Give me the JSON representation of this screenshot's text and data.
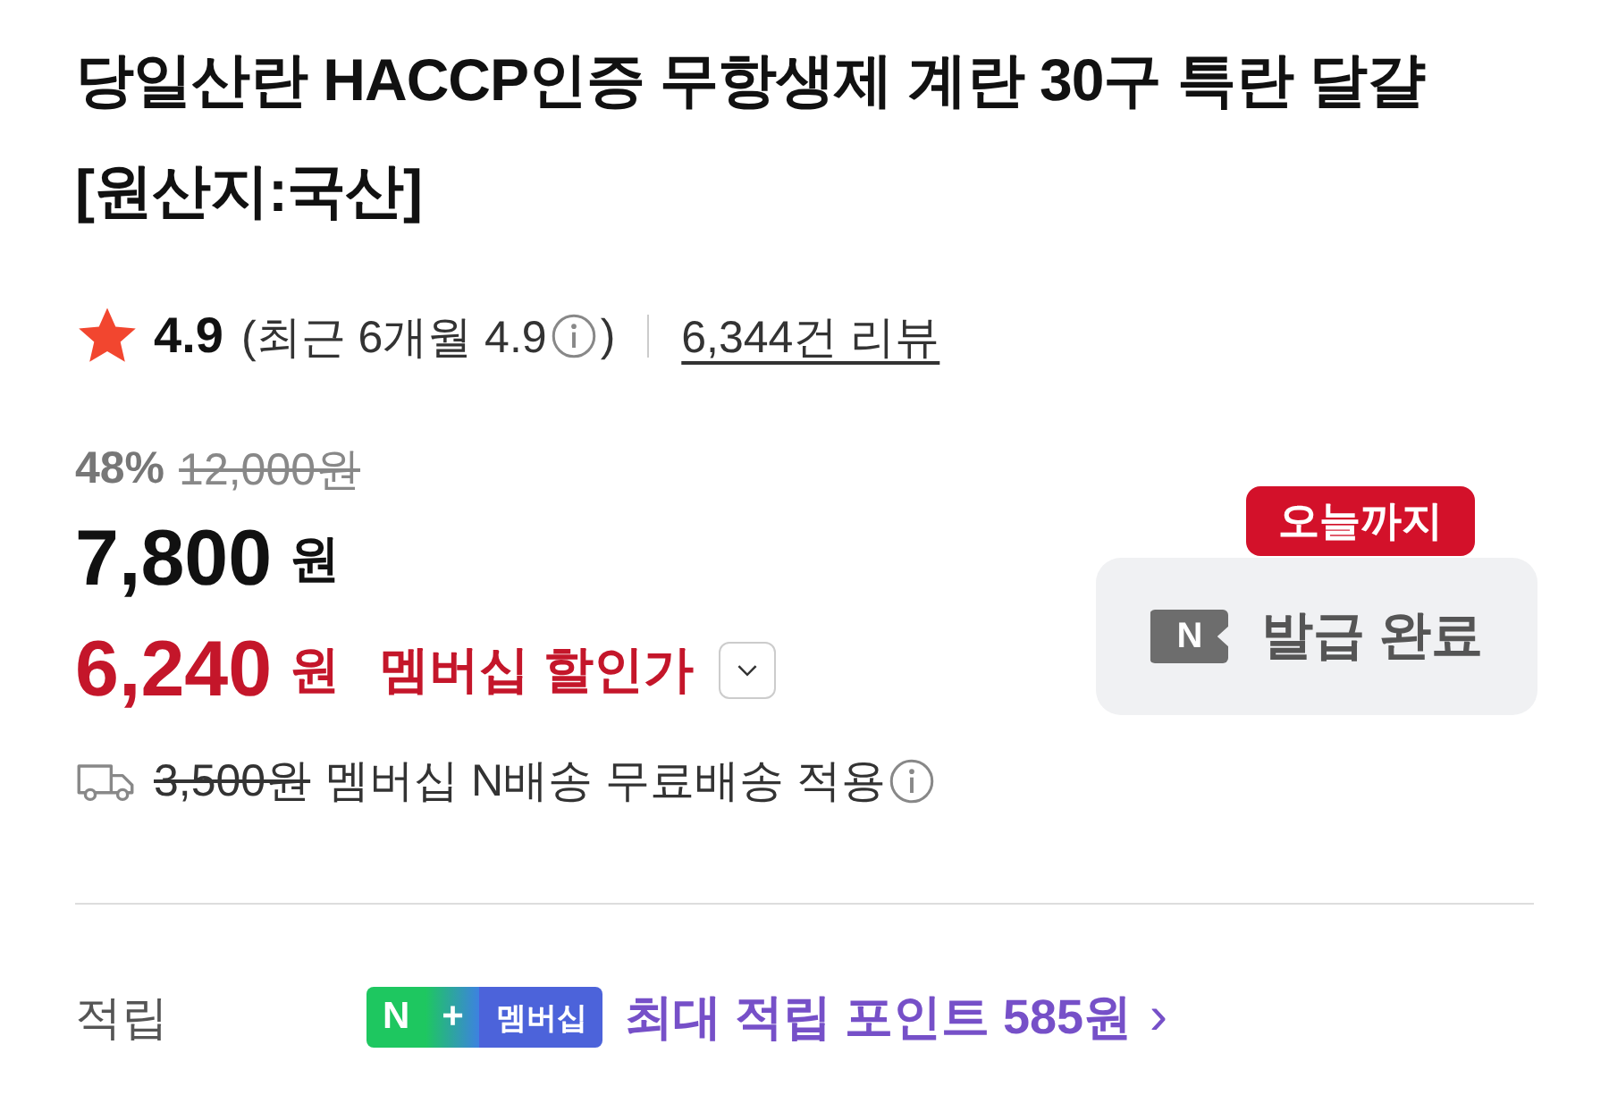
{
  "product": {
    "title": "당일산란 HACCP인증 무항생제 계란 30구 특란 달걀 [원산지:국산]"
  },
  "rating": {
    "score": "4.9",
    "recent": "(최근 6개월 4.9",
    "recent_close": ")",
    "reviews": "6,344건 리뷰"
  },
  "price": {
    "discount": "48%",
    "original": "12,000원",
    "sale": "7,800",
    "sale_unit": "원",
    "member_price": "6,240",
    "member_unit": "원",
    "member_label": "멤버십 할인가"
  },
  "coupon": {
    "badge": "오늘까지",
    "logo": "N",
    "label": "발급 완료"
  },
  "shipping": {
    "original_fee": "3,500원",
    "text": "멤버십 N배송 무료배송 적용"
  },
  "points": {
    "label": "적립",
    "badge": [
      "N",
      "+",
      "멤버십"
    ],
    "text": "최대 적립 포인트 585원",
    "chevron": "›"
  }
}
